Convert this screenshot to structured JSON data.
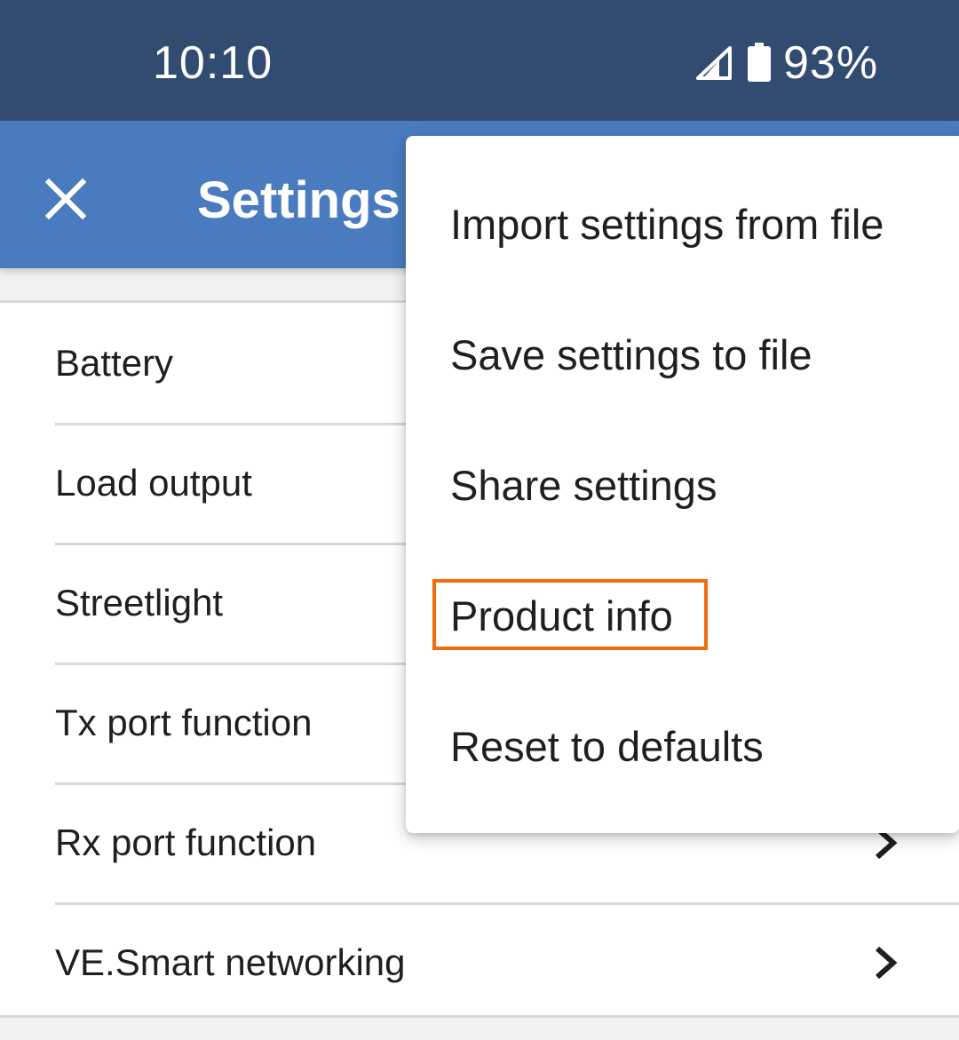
{
  "status_bar": {
    "time": "10:10",
    "battery_percent": "93%",
    "icons": [
      "signal-icon",
      "battery-icon"
    ]
  },
  "app_bar": {
    "title": "Settings",
    "close_icon": "close-icon"
  },
  "settings_list": {
    "items": [
      {
        "label": "Battery",
        "icon": "chevron-right-icon"
      },
      {
        "label": "Load output",
        "icon": "chevron-right-icon"
      },
      {
        "label": "Streetlight",
        "icon": "chevron-right-icon"
      },
      {
        "label": "Tx port function",
        "icon": "chevron-right-icon"
      },
      {
        "label": "Rx port function",
        "icon": "chevron-right-icon"
      },
      {
        "label": "VE.Smart networking",
        "icon": "chevron-right-icon"
      }
    ]
  },
  "overflow_menu": {
    "items": [
      {
        "label": "Import settings from file"
      },
      {
        "label": "Save settings to file"
      },
      {
        "label": "Share settings"
      },
      {
        "label": "Product info",
        "highlighted": true
      },
      {
        "label": "Reset to defaults"
      }
    ]
  },
  "colors": {
    "status_bar": "#324c71",
    "app_bar": "#4a7bbf",
    "highlight": "#f26c0d"
  }
}
